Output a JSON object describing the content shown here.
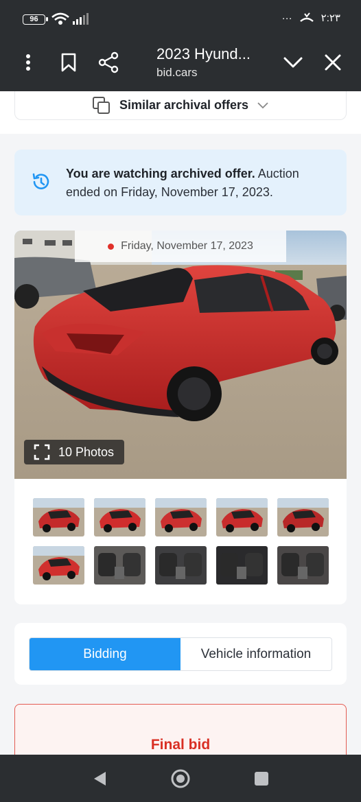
{
  "status_bar": {
    "battery": "96",
    "time": "٢:٢٣",
    "more": "···"
  },
  "header": {
    "title": "2023 Hyund...",
    "domain": "bid.cars"
  },
  "similar": {
    "label": "Similar archival offers"
  },
  "notice": {
    "bold": "You are watching archived offer.",
    "rest": " Auction ended on Friday, November 17, 2023."
  },
  "gallery": {
    "date": "Friday, November 17, 2023",
    "photos_label": "10 Photos",
    "thumbnails": [
      {
        "name": "thumb-front-left",
        "color": "#c42a2a"
      },
      {
        "name": "thumb-rear-left",
        "color": "#d02d2d"
      },
      {
        "name": "thumb-rear-right",
        "color": "#cc3030"
      },
      {
        "name": "thumb-side",
        "color": "#c82c2c"
      },
      {
        "name": "thumb-front",
        "color": "#b82828"
      },
      {
        "name": "thumb-rear",
        "color": "#d0302e"
      },
      {
        "name": "thumb-interior-seats",
        "color": "#5c5a58"
      },
      {
        "name": "thumb-dashboard",
        "color": "#3e3e40"
      },
      {
        "name": "thumb-gauges",
        "color": "#2a2a2c"
      },
      {
        "name": "thumb-seat-closeup",
        "color": "#4a4747"
      }
    ]
  },
  "tabs": [
    {
      "label": "Bidding",
      "active": true
    },
    {
      "label": "Vehicle information",
      "active": false
    }
  ],
  "final_bid": {
    "label": "Final bid"
  },
  "colors": {
    "accent": "#2196f3",
    "dark": "#2b2e31",
    "alert_red": "#d92f24"
  }
}
